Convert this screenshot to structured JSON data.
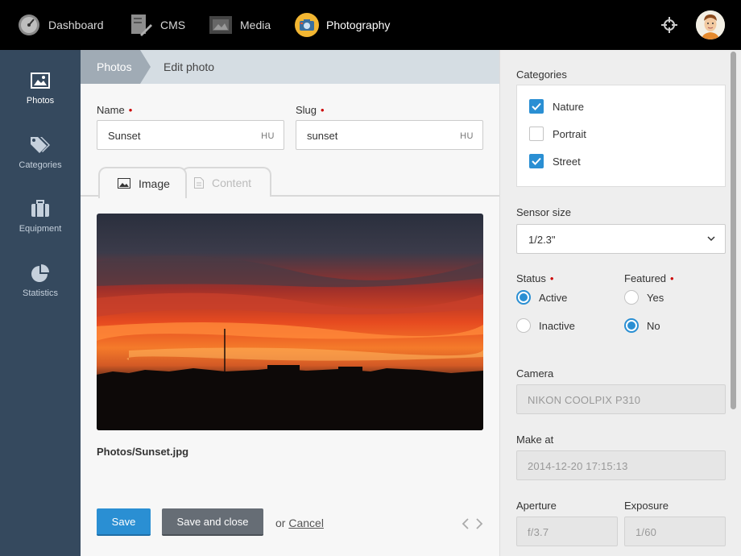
{
  "topnav": {
    "items": [
      {
        "label": "Dashboard",
        "icon": "speedometer-icon"
      },
      {
        "label": "CMS",
        "icon": "document-pen-icon"
      },
      {
        "label": "Media",
        "icon": "film-image-icon"
      },
      {
        "label": "Photography",
        "icon": "camera-icon"
      }
    ],
    "active": "Photography"
  },
  "sidebar": {
    "items": [
      {
        "label": "Photos",
        "icon": "image-icon"
      },
      {
        "label": "Categories",
        "icon": "tags-icon"
      },
      {
        "label": "Equipment",
        "icon": "suitcase-icon"
      },
      {
        "label": "Statistics",
        "icon": "pie-chart-icon"
      }
    ],
    "active": "Photos"
  },
  "breadcrumb": {
    "root": "Photos",
    "current": "Edit photo"
  },
  "form": {
    "name": {
      "label": "Name",
      "value": "Sunset",
      "lang": "HU"
    },
    "slug": {
      "label": "Slug",
      "value": "sunset",
      "lang": "HU"
    },
    "tabs": [
      {
        "label": "Image"
      },
      {
        "label": "Content"
      }
    ],
    "file_path": "Photos/Sunset.jpg"
  },
  "actions": {
    "save": "Save",
    "save_close": "Save and close",
    "or": "or",
    "cancel": "Cancel"
  },
  "panel": {
    "categories": {
      "label": "Categories",
      "items": [
        {
          "label": "Nature",
          "checked": true
        },
        {
          "label": "Portrait",
          "checked": false
        },
        {
          "label": "Street",
          "checked": true
        }
      ]
    },
    "sensor": {
      "label": "Sensor size",
      "value": "1/2.3\""
    },
    "status": {
      "label": "Status",
      "options": [
        "Active",
        "Inactive"
      ],
      "selected": "Active"
    },
    "featured": {
      "label": "Featured",
      "options": [
        "Yes",
        "No"
      ],
      "selected": "No"
    },
    "camera": {
      "label": "Camera",
      "value": "NIKON COOLPIX P310"
    },
    "make_at": {
      "label": "Make at",
      "value": "2014-12-20 17:15:13"
    },
    "aperture": {
      "label": "Aperture",
      "value": "f/3.7"
    },
    "exposure": {
      "label": "Exposure",
      "value": "1/60"
    }
  },
  "colors": {
    "accent": "#2a8fd3",
    "sidebar": "#35495e",
    "topbar": "#000000",
    "required": "#cc0000"
  }
}
